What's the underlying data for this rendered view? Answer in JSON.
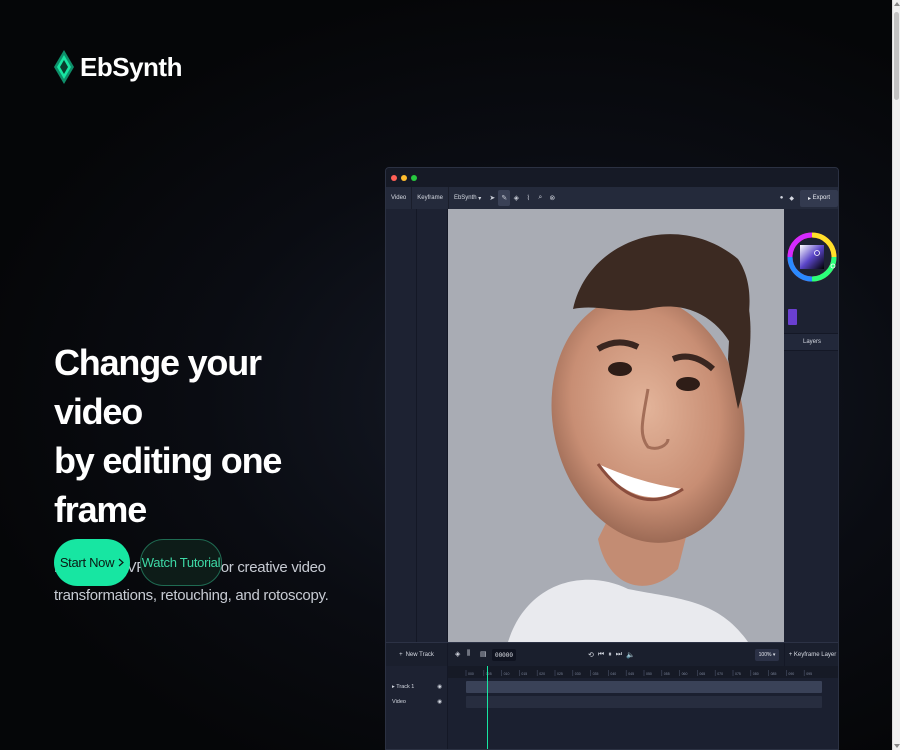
{
  "brand": {
    "name": "EbSynth",
    "accent": "#17e6a2"
  },
  "hero": {
    "title_line1": "Change your video",
    "title_line2": "by editing one frame",
    "subtitle": "EbSynth is VFX software for creative video transformations, retouching, and rotoscopy."
  },
  "cta": {
    "primary": "Start Now",
    "secondary": "Watch Tutorial"
  },
  "app": {
    "toolbar": {
      "tabs": [
        "Video",
        "Keyframe",
        "EbSynth"
      ],
      "export_label": "Export"
    },
    "right_panel": {
      "layers_label": "Layers",
      "swatch_color": "#6a3fd0"
    },
    "controls": {
      "new_track_label": "New Track",
      "frame_counter": "00000",
      "zoom_value": "100%",
      "keyframe_layer_label": "Keyframe Layer"
    },
    "ruler_ticks": [
      "000",
      "005",
      "010",
      "015",
      "020",
      "025",
      "030",
      "035",
      "040",
      "045",
      "050",
      "055",
      "060",
      "065",
      "070",
      "075",
      "080",
      "085",
      "090",
      "095"
    ],
    "tracks": [
      {
        "label": "Track 1"
      },
      {
        "label": "Video"
      }
    ]
  },
  "icons": {
    "window_dots": [
      "#ff5f56",
      "#ffbd2e",
      "#27c93f"
    ],
    "tools": [
      "select-icon",
      "brush-icon",
      "eraser-icon",
      "fill-icon",
      "picker-icon",
      "lasso-icon",
      "smudge-icon"
    ]
  }
}
